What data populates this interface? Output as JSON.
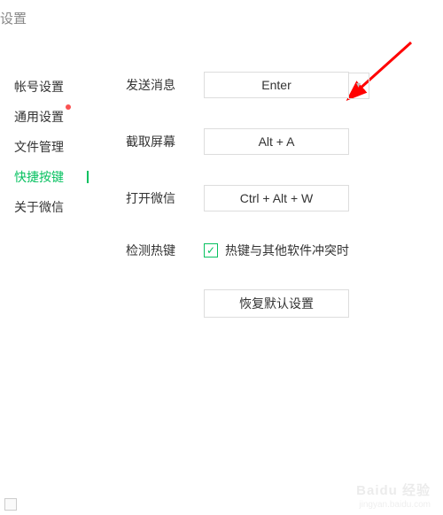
{
  "window": {
    "title": "设置"
  },
  "sidebar": {
    "items": [
      {
        "label": "帐号设置"
      },
      {
        "label": "通用设置"
      },
      {
        "label": "文件管理"
      },
      {
        "label": "快捷按键"
      },
      {
        "label": "关于微信"
      }
    ]
  },
  "content": {
    "rows": {
      "send": {
        "label": "发送消息",
        "value": "Enter"
      },
      "screenshot": {
        "label": "截取屏幕",
        "value": "Alt + A"
      },
      "open": {
        "label": "打开微信",
        "value": "Ctrl + Alt + W"
      },
      "detect": {
        "label": "检测热键",
        "checkbox_label": "热键与其他软件冲突时"
      }
    },
    "reset_label": "恢复默认设置"
  },
  "watermark": {
    "main": "Baidu 经验",
    "sub": "jingyan.baidu.com"
  }
}
